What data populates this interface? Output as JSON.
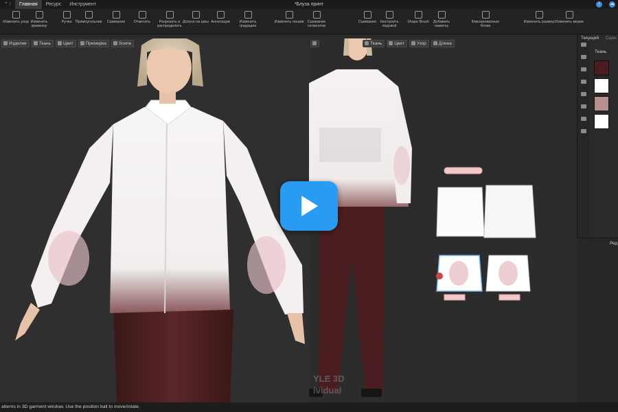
{
  "window": {
    "title": "*Блуза принт"
  },
  "menu": {
    "tabs": [
      "Главная",
      "Ресурс",
      "Инструмент"
    ]
  },
  "ribbon": {
    "tools": [
      "Изменить узор",
      "Изменить кривизну",
      "Ручка",
      "Прямоугольник",
      "Сшивание",
      "Отметить",
      "Разрезать и распределить",
      "Допуск на швы",
      "Аннотации",
      "Изменить градацию",
      "Изменить пошив",
      "Сшивание сегментов",
      "Сшивание",
      "Настроить подсвой",
      "Shape Brush",
      "Добавить наметку",
      "Фиксированные блоки",
      "Изменить размер",
      "Изменить мерки"
    ]
  },
  "left_view": {
    "toolbar": [
      "Изделие",
      "Ткань",
      "Цвет",
      "Примерка",
      "Scene"
    ]
  },
  "right_view": {
    "toolbar": [
      "Ткань",
      "Цвет",
      "Узор",
      "Длина"
    ]
  },
  "panel": {
    "tabs": [
      "Текущий",
      "Сцен"
    ],
    "section": "Ткань",
    "swatches": [
      "#4a1c1f",
      "#ffffff",
      "#b89090",
      "#ffffff"
    ],
    "lower_label": "Ред"
  },
  "watermark": {
    "line1": "YLE 3D",
    "line2": "ividual"
  },
  "status": {
    "text": "atterns in 3D garment window. Use the position ball to move/rotate."
  },
  "colors": {
    "play_button": "#2a9bf2",
    "accent": "#3f8ee8"
  }
}
